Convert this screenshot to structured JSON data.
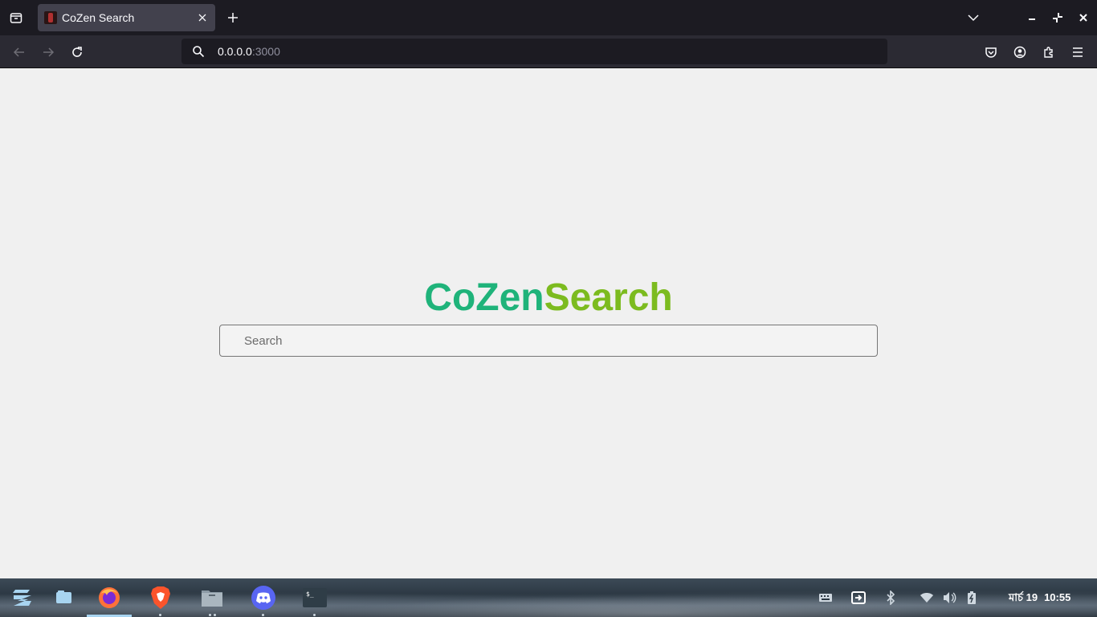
{
  "browser": {
    "tab_title": "CoZen Search",
    "url_host": "0.0.0.0",
    "url_port": ":3000"
  },
  "page": {
    "brand_part1": "CoZen",
    "brand_part2": "Search",
    "search_placeholder": "Search",
    "brand_colors": {
      "part1": "#1fb37a",
      "part2": "#7cbb1f"
    }
  },
  "taskbar": {
    "apps": [
      "zorin-menu",
      "workspaces",
      "firefox",
      "brave",
      "files",
      "discord",
      "terminal"
    ],
    "clock_date": "মার্চ 19",
    "clock_time": "10:55"
  }
}
